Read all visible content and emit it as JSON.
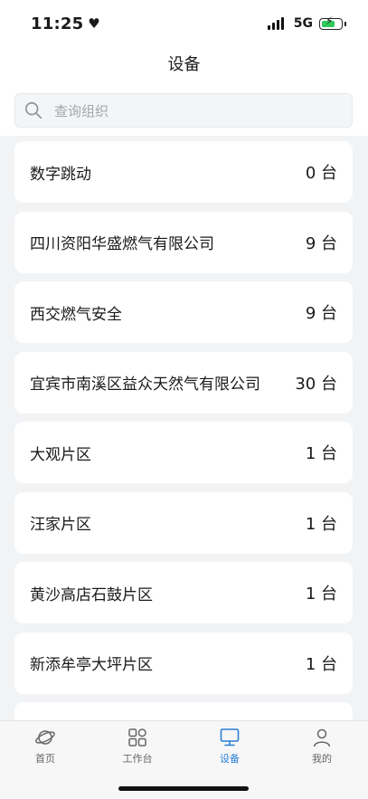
{
  "status": {
    "time": "11:25",
    "network": "5G"
  },
  "header": {
    "title": "设备"
  },
  "search": {
    "placeholder": "查询组织"
  },
  "organizations": [
    {
      "name": "数字跳动",
      "count": "0 台"
    },
    {
      "name": "四川资阳华盛燃气有限公司",
      "count": "9 台"
    },
    {
      "name": "西交燃气安全",
      "count": "9 台"
    },
    {
      "name": "宜宾市南溪区益众天然气有限公司",
      "count": "30 台"
    },
    {
      "name": "大观片区",
      "count": "1 台"
    },
    {
      "name": "汪家片区",
      "count": "1 台"
    },
    {
      "name": "黄沙高店石鼓片区",
      "count": "1 台"
    },
    {
      "name": "新添牟亭大坪片区",
      "count": "1 台"
    },
    {
      "name": "",
      "count": ""
    }
  ],
  "tabbar": {
    "items": [
      {
        "label": "首页",
        "icon": "planet-icon",
        "active": false
      },
      {
        "label": "工作台",
        "icon": "grid-icon",
        "active": false
      },
      {
        "label": "设备",
        "icon": "monitor-icon",
        "active": true
      },
      {
        "label": "我的",
        "icon": "person-icon",
        "active": false
      }
    ]
  },
  "colors": {
    "accent": "#2a7fd4",
    "background": "#f2f3f5",
    "battery": "#30c85a"
  }
}
